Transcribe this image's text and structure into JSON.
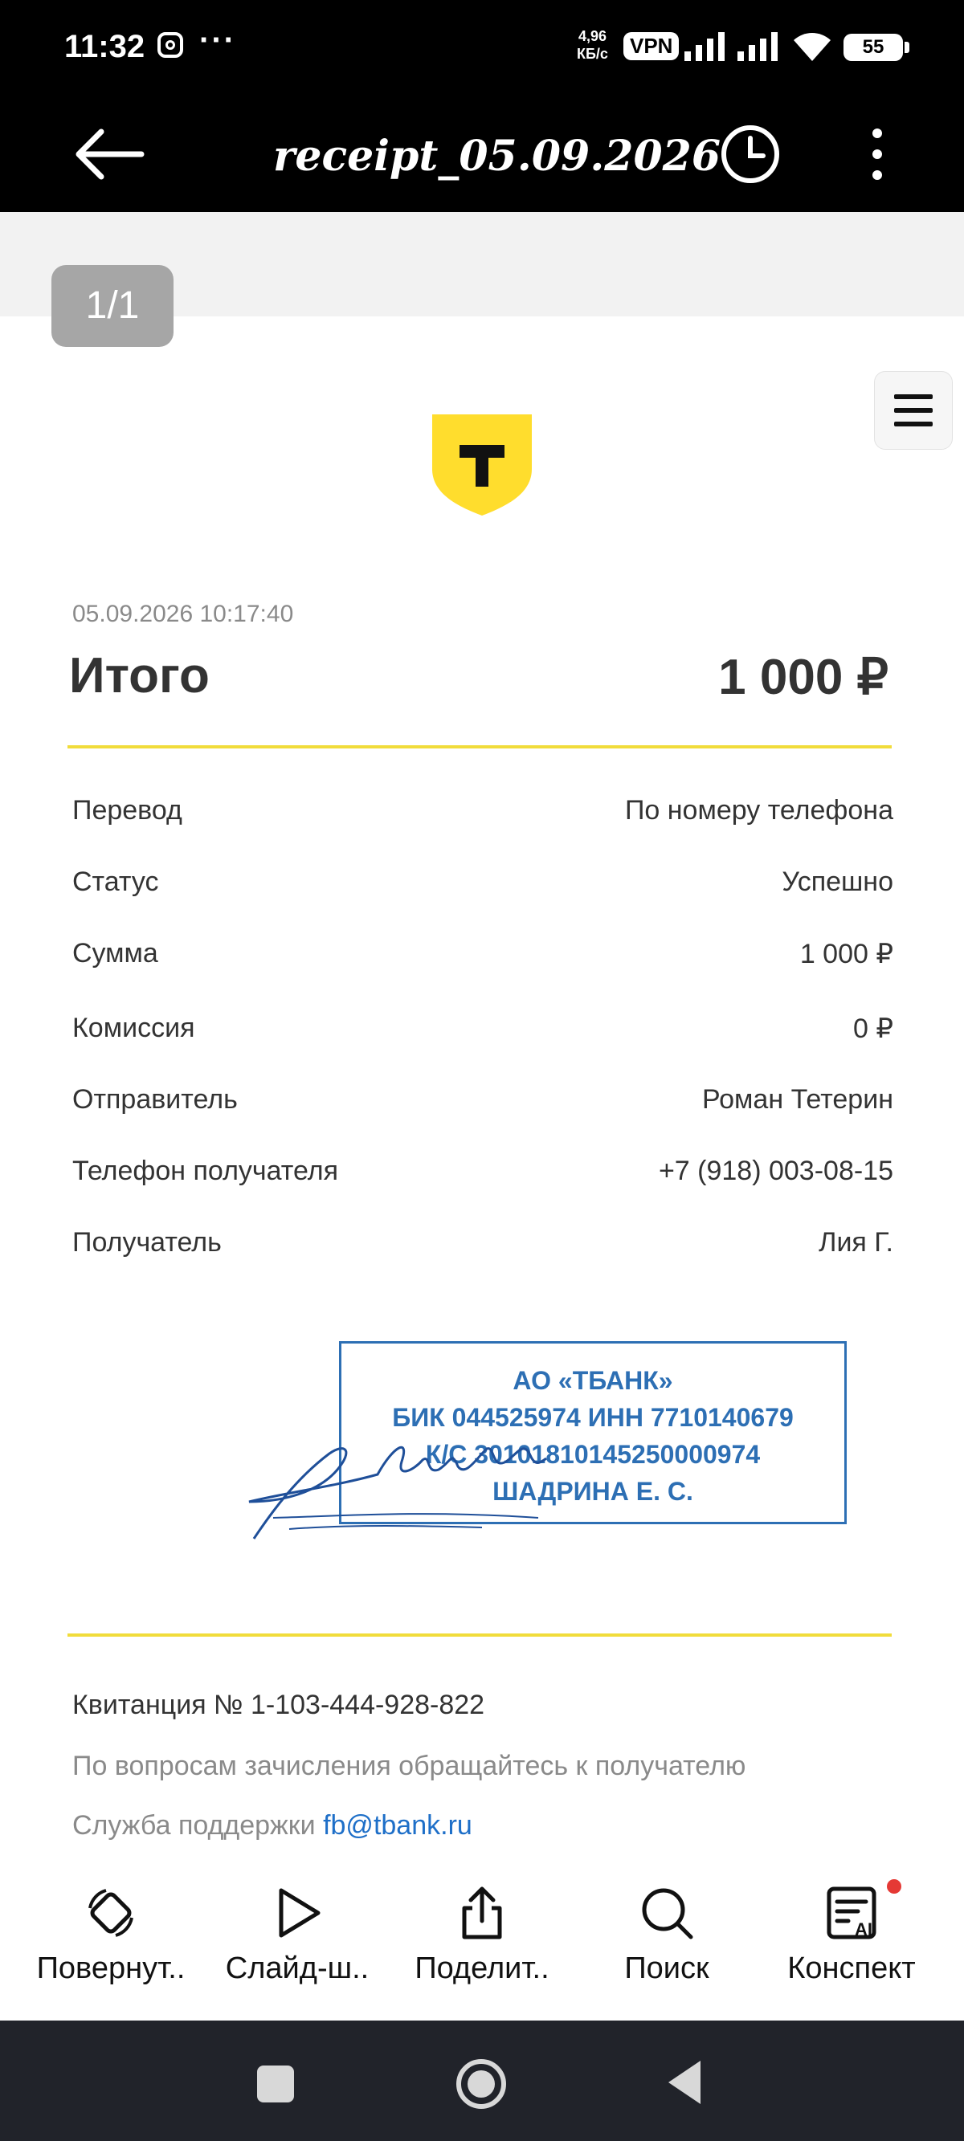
{
  "status_bar": {
    "time": "11:32",
    "speed_value": "4,96",
    "speed_unit": "КБ/с",
    "vpn": "VPN",
    "battery": "55"
  },
  "app_bar": {
    "title": "receipt_05.09.2026"
  },
  "viewer": {
    "page_indicator": "1/1"
  },
  "receipt": {
    "datetime": "05.09.2026  10:17:40",
    "total_label": "Итого",
    "total_value": "1 000 ₽",
    "rows": [
      {
        "label": "Перевод",
        "value": "По номеру телефона"
      },
      {
        "label": "Статус",
        "value": "Успешно"
      },
      {
        "label": "Сумма",
        "value": "1 000 ₽"
      },
      {
        "label": "Комиссия",
        "value": "0 ₽"
      },
      {
        "label": "Отправитель",
        "value": "Роман Тетерин"
      },
      {
        "label": "Телефон получателя",
        "value": "+7 (918) 003-08-15"
      },
      {
        "label": "Получатель",
        "value": "Лия Г."
      }
    ],
    "stamp": {
      "line1": "АО «ТБАНК»",
      "line2": "БИК 044525974 ИНН 7710140679",
      "line3": "К/С 30101810145250000974",
      "line4": "ШАДРИНА Е. С."
    },
    "receipt_number": "Квитанция  № 1-103-444-928-822",
    "note": "По вопросам зачисления обращайтесь к получателю",
    "support_label": "Служба поддержки ",
    "support_email": "fb@tbank.ru"
  },
  "tools": [
    {
      "label": "Повернут..",
      "icon": "rotate-icon"
    },
    {
      "label": "Слайд-ш..",
      "icon": "play-icon"
    },
    {
      "label": "Поделит..",
      "icon": "share-icon"
    },
    {
      "label": "Поиск",
      "icon": "search-icon"
    },
    {
      "label": "Конспект",
      "icon": "summary-ai-icon"
    }
  ],
  "colors": {
    "accent_yellow": "#f1dc3b",
    "stamp_blue": "#2d6fb4",
    "link_blue": "#1e6fc8",
    "logo_yellow": "#ffdd2d"
  }
}
